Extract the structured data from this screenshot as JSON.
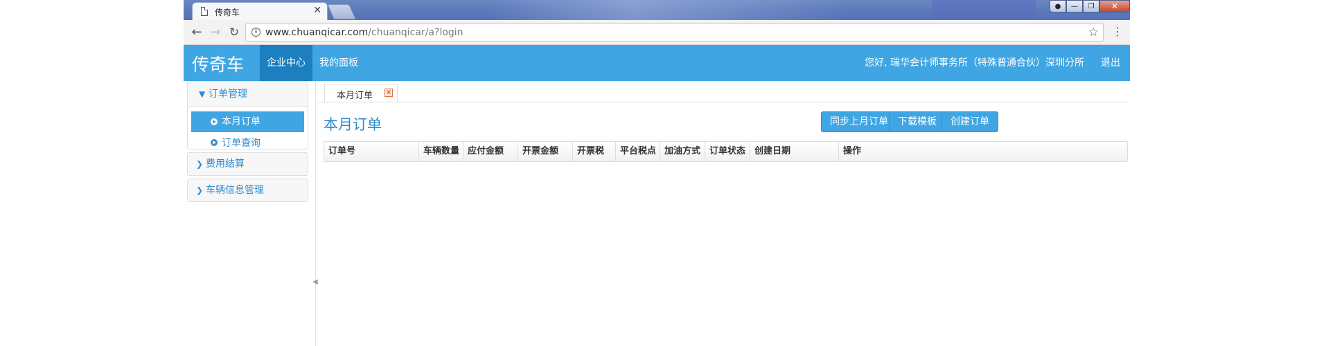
{
  "browser": {
    "tab_title": "传奇车",
    "close_glyph": "✕",
    "url_host": "www.chuanqicar.com",
    "url_path": "/chuanqicar/a?login"
  },
  "header": {
    "brand": "传奇车",
    "nav": [
      {
        "label": "企业中心",
        "active": true
      },
      {
        "label": "我的面板",
        "active": false
      }
    ],
    "greeting": "您好, 瑞华会计师事务所（特殊普通合伙）深圳分所",
    "logout": "退出"
  },
  "sidebar": {
    "groups": [
      {
        "label": "订单管理",
        "expanded": true,
        "items": [
          {
            "label": "本月订单",
            "active": true
          },
          {
            "label": "订单查询",
            "active": false
          }
        ]
      },
      {
        "label": "费用结算",
        "expanded": false
      },
      {
        "label": "车辆信息管理",
        "expanded": false
      }
    ]
  },
  "content": {
    "tab_label": "本月订单",
    "title": "本月订单",
    "buttons": {
      "sync": "同步上月订单",
      "download": "下载模板",
      "create": "创建订单"
    },
    "columns": [
      "订单号",
      "车辆数量",
      "应付金额",
      "开票金额",
      "开票税",
      "平台税点",
      "加油方式",
      "订单状态",
      "创建日期",
      "操作"
    ]
  },
  "colors": {
    "accent": "#3fa5e3",
    "accent_dark": "#1c7fc0",
    "link": "#2d8ccf"
  }
}
